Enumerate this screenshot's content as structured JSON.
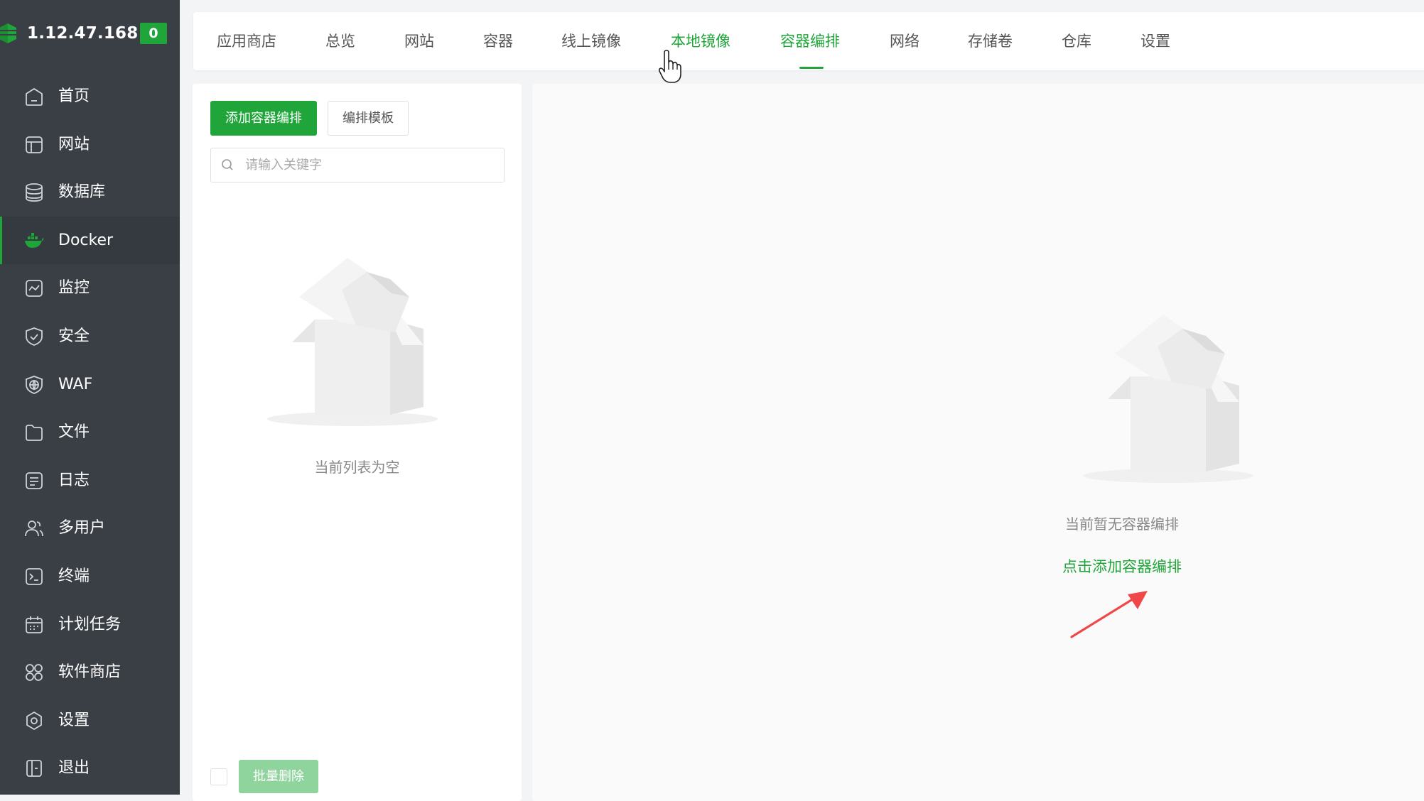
{
  "sidebar": {
    "ip": "1.12.47.168",
    "badge": "0",
    "items": [
      {
        "label": "首页",
        "icon": "home-icon"
      },
      {
        "label": "网站",
        "icon": "website-icon"
      },
      {
        "label": "数据库",
        "icon": "database-icon"
      },
      {
        "label": "Docker",
        "icon": "docker-icon",
        "active": true
      },
      {
        "label": "监控",
        "icon": "monitor-icon"
      },
      {
        "label": "安全",
        "icon": "shield-icon"
      },
      {
        "label": "WAF",
        "icon": "waf-icon"
      },
      {
        "label": "文件",
        "icon": "folder-icon"
      },
      {
        "label": "日志",
        "icon": "log-icon"
      },
      {
        "label": "多用户",
        "icon": "users-icon"
      },
      {
        "label": "终端",
        "icon": "terminal-icon"
      },
      {
        "label": "计划任务",
        "icon": "calendar-icon"
      },
      {
        "label": "软件商店",
        "icon": "apps-icon"
      },
      {
        "label": "设置",
        "icon": "gear-icon"
      },
      {
        "label": "退出",
        "icon": "logout-icon"
      }
    ]
  },
  "tabs": [
    {
      "label": "应用商店"
    },
    {
      "label": "总览"
    },
    {
      "label": "网站"
    },
    {
      "label": "容器"
    },
    {
      "label": "线上镜像"
    },
    {
      "label": "本地镜像",
      "hover": true
    },
    {
      "label": "容器编排",
      "active": true
    },
    {
      "label": "网络"
    },
    {
      "label": "存储卷"
    },
    {
      "label": "仓库"
    },
    {
      "label": "设置"
    }
  ],
  "left": {
    "add_button": "添加容器编排",
    "template_button": "编排模板",
    "search_placeholder": "请输入关键字",
    "empty_text": "当前列表为空",
    "batch_delete": "批量删除"
  },
  "right": {
    "empty_text": "当前暂无容器编排",
    "add_link": "点击添加容器编排"
  },
  "colors": {
    "accent": "#20a53a",
    "sidebar_bg": "#3a3f46",
    "arrow": "#f04848"
  }
}
